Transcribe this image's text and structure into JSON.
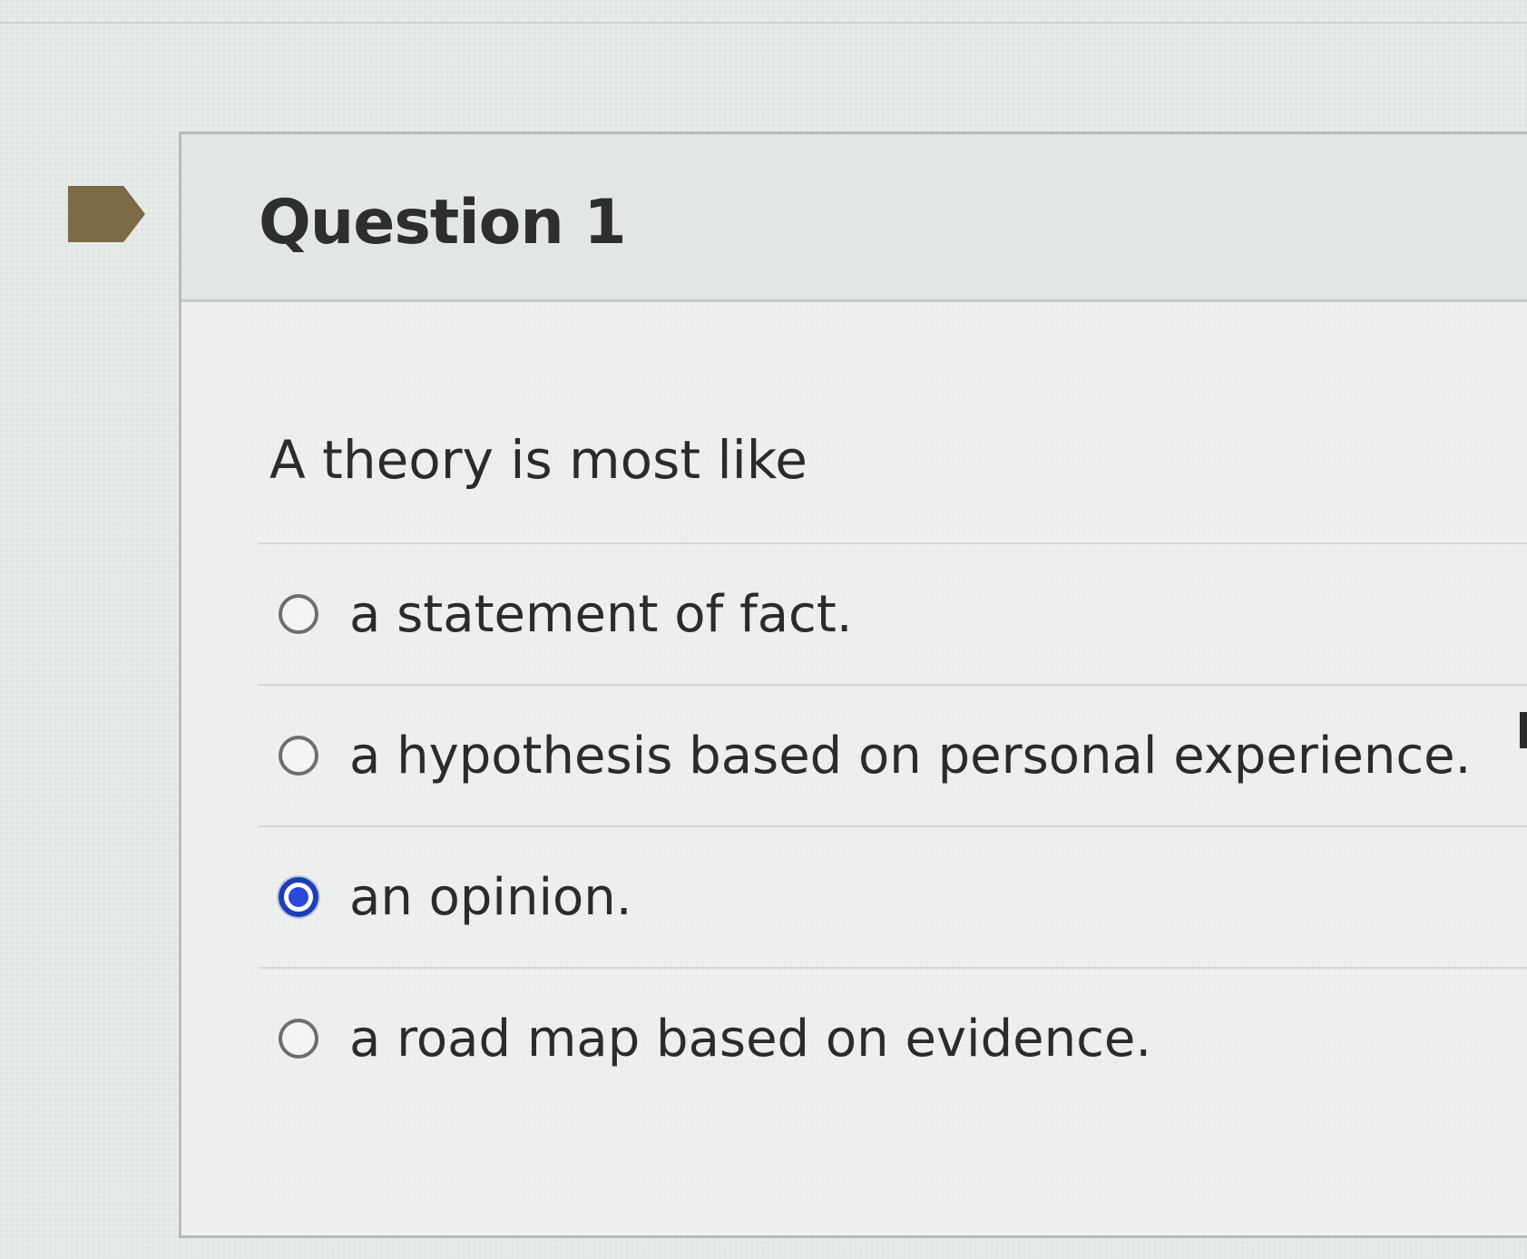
{
  "question": {
    "title": "Question 1",
    "prompt": "A theory is most like"
  },
  "choices": [
    {
      "label": "a statement of fact.",
      "selected": false
    },
    {
      "label": "a hypothesis based on personal experience.",
      "selected": false
    },
    {
      "label": "an opinion.",
      "selected": true
    },
    {
      "label": "a road map based on evidence.",
      "selected": false
    }
  ],
  "colors": {
    "flag": "#7c6a45",
    "selected_radio": "#2a49d8"
  },
  "icons": {
    "flag": "flag-icon"
  }
}
